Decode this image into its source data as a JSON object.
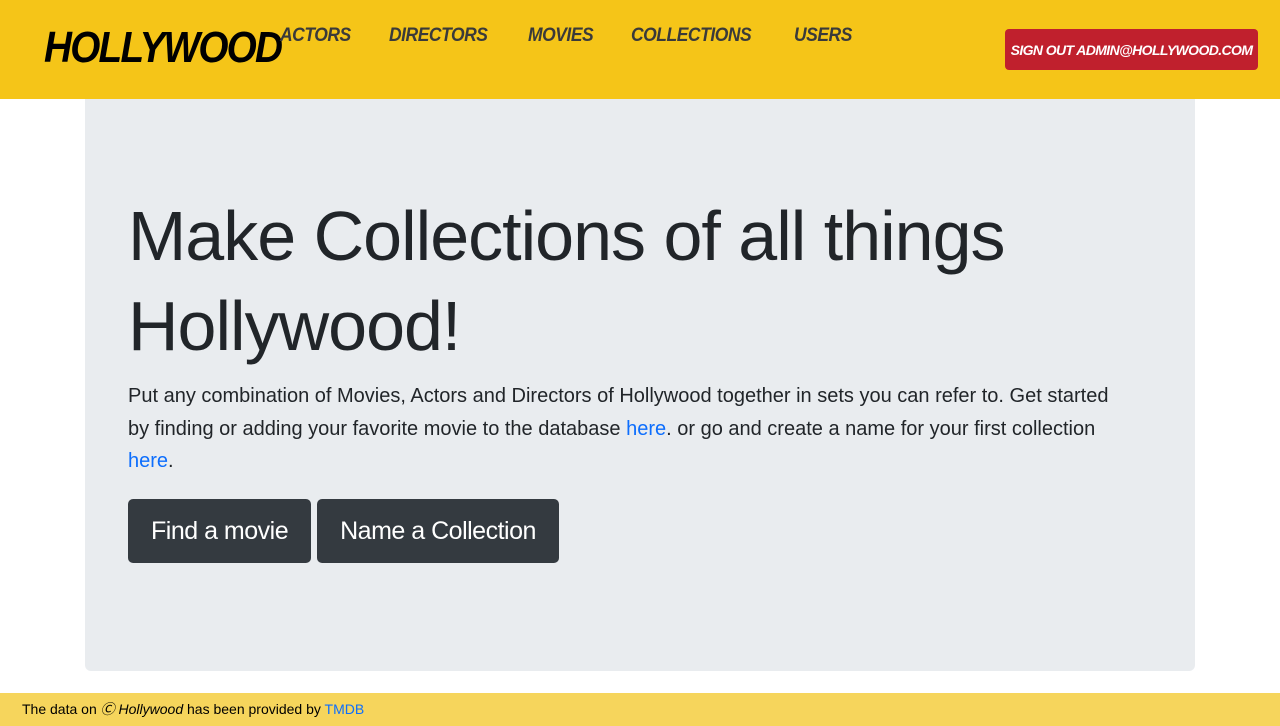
{
  "navbar": {
    "brand": "HOLLYWOOD",
    "links": [
      "ACTORS",
      "DIRECTORS",
      "MOVIES",
      "COLLECTIONS",
      "USERS"
    ],
    "signout_label": "SIGN OUT ADMIN@HOLLYWOOD.COM"
  },
  "hero": {
    "title": "Make Collections of all things Hollywood!",
    "lead_part1": "Put any combination of Movies, Actors and Directors of Hollywood together in sets you can refer to. Get started by finding or adding your favorite movie to the database ",
    "link1": "here",
    "lead_part2": ". or go and create a name for your first collection ",
    "link2": "here",
    "lead_part3": ".",
    "buttons": [
      "Find a movie",
      "Name a Collection"
    ]
  },
  "footer": {
    "prefix": "The data on ",
    "copyright_symbol": "Ⓒ",
    "site_name": "Hollywood",
    "middle": " has been provided by ",
    "provider_link": "TMDB"
  },
  "colors": {
    "navbar_bg": "#f5c518",
    "signout_bg": "#c0202d",
    "jumbotron_bg": "#e9ecef",
    "button_bg": "#343a40",
    "link": "#0d6efd",
    "footer_bg": "#f6d55c"
  }
}
